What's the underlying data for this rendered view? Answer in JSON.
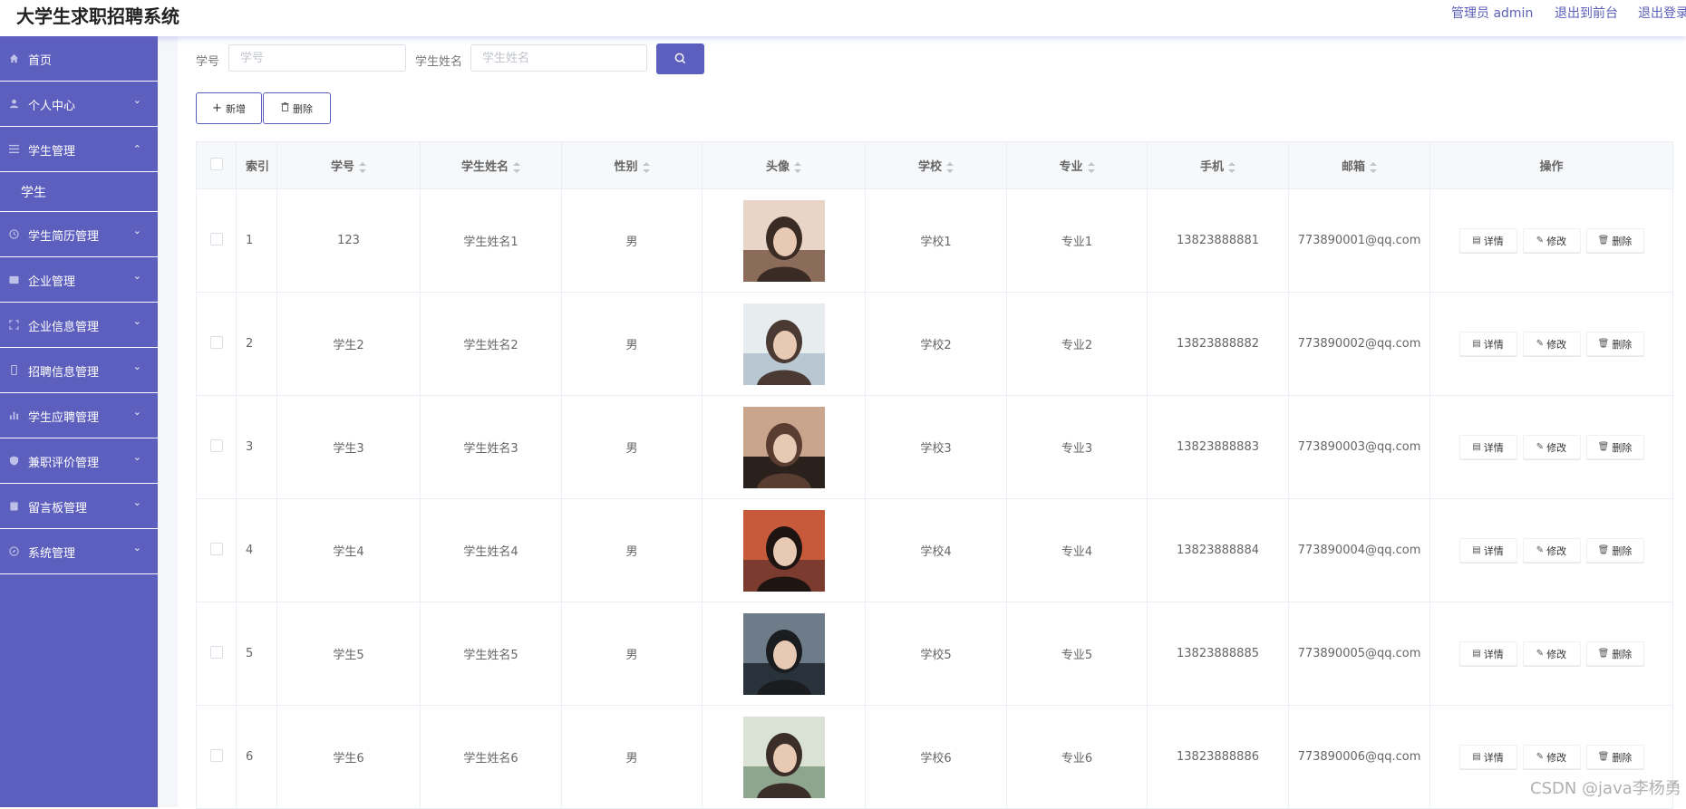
{
  "header": {
    "title": "大学生求职招聘系统",
    "admin_label": "管理员 admin",
    "front_link": "退出到前台",
    "logout_link": "退出登录"
  },
  "sidebar": {
    "items": [
      {
        "label": "首页",
        "icon": "home-icon",
        "arrow": ""
      },
      {
        "label": "个人中心",
        "icon": "user-icon",
        "arrow": "chevron-down"
      },
      {
        "label": "学生管理",
        "icon": "menu-icon",
        "arrow": "chevron-up"
      },
      {
        "label": "学生",
        "icon": "",
        "arrow": ""
      },
      {
        "label": "学生简历管理",
        "icon": "clock-icon",
        "arrow": "chevron-down"
      },
      {
        "label": "企业管理",
        "icon": "folder-icon",
        "arrow": "chevron-down"
      },
      {
        "label": "企业信息管理",
        "icon": "frame-icon",
        "arrow": "chevron-down"
      },
      {
        "label": "招聘信息管理",
        "icon": "phone-icon",
        "arrow": "chevron-down"
      },
      {
        "label": "学生应聘管理",
        "icon": "bar-chart-icon",
        "arrow": "chevron-down"
      },
      {
        "label": "兼职评价管理",
        "icon": "shield-icon",
        "arrow": "chevron-down"
      },
      {
        "label": "留言板管理",
        "icon": "clipboard-icon",
        "arrow": "chevron-down"
      },
      {
        "label": "系统管理",
        "icon": "compass-icon",
        "arrow": "chevron-down"
      }
    ]
  },
  "search": {
    "id_label": "学号",
    "id_placeholder": "学号",
    "name_label": "学生姓名",
    "name_placeholder": "学生姓名"
  },
  "toolbar": {
    "add_label": "新增",
    "delete_label": "删除"
  },
  "table": {
    "headers": {
      "index": "索引",
      "student_id": "学号",
      "name": "学生姓名",
      "gender": "性别",
      "avatar": "头像",
      "school": "学校",
      "major": "专业",
      "phone": "手机",
      "email": "邮箱",
      "actions": "操作"
    },
    "action_labels": {
      "detail": "详情",
      "edit": "修改",
      "delete": "删除"
    },
    "rows": [
      {
        "index": "1",
        "student_id": "123",
        "name": "学生姓名1",
        "gender": "男",
        "school": "学校1",
        "major": "专业1",
        "phone": "13823888881",
        "email": "773890001@qq.com"
      },
      {
        "index": "2",
        "student_id": "学生2",
        "name": "学生姓名2",
        "gender": "男",
        "school": "学校2",
        "major": "专业2",
        "phone": "13823888882",
        "email": "773890002@qq.com"
      },
      {
        "index": "3",
        "student_id": "学生3",
        "name": "学生姓名3",
        "gender": "男",
        "school": "学校3",
        "major": "专业3",
        "phone": "13823888883",
        "email": "773890003@qq.com"
      },
      {
        "index": "4",
        "student_id": "学生4",
        "name": "学生姓名4",
        "gender": "男",
        "school": "学校4",
        "major": "专业4",
        "phone": "13823888884",
        "email": "773890004@qq.com"
      },
      {
        "index": "5",
        "student_id": "学生5",
        "name": "学生姓名5",
        "gender": "男",
        "school": "学校5",
        "major": "专业5",
        "phone": "13823888885",
        "email": "773890005@qq.com"
      },
      {
        "index": "6",
        "student_id": "学生6",
        "name": "学生姓名6",
        "gender": "男",
        "school": "学校6",
        "major": "专业6",
        "phone": "13823888886",
        "email": "773890006@qq.com"
      }
    ]
  },
  "watermark": "CSDN @java李杨勇",
  "colors": {
    "accent": "#5d5fbe",
    "sidebar_bg": "#5d5fbe",
    "header_bg": "#f7f8fa"
  }
}
